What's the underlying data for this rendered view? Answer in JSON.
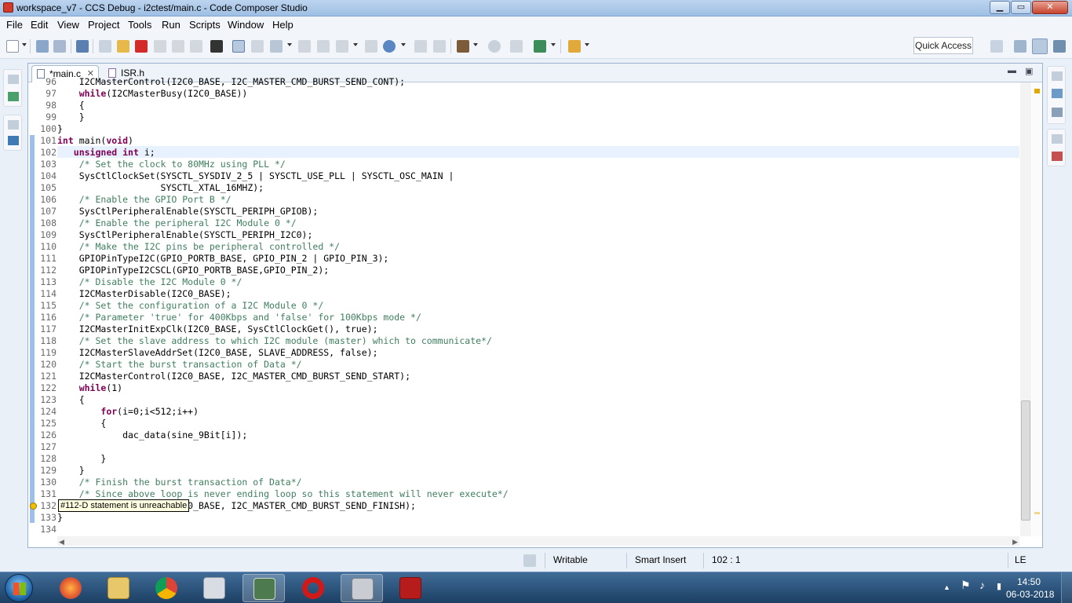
{
  "window": {
    "title": "workspace_v7 - CCS Debug - i2ctest/main.c - Code Composer Studio",
    "minimize_glyph": "▁",
    "maximize_glyph": "▭",
    "close_glyph": "✕"
  },
  "menu": [
    "File",
    "Edit",
    "View",
    "Project",
    "Tools",
    "Run",
    "Scripts",
    "Window",
    "Help"
  ],
  "toolbar": {
    "quick_access_label": "Quick Access",
    "icons": [
      "new-icon",
      "save-icon",
      "save-all-icon",
      "debug-view-icon",
      "resume-icon",
      "suspend-icon",
      "terminate-icon",
      "step-into-icon",
      "step-over-icon",
      "step-return-icon",
      "memory-icon",
      "build-icon",
      "debug-icon",
      "pin-icon",
      "tools-icon",
      "search-icon",
      "perspective-icon"
    ]
  },
  "tabs": [
    {
      "label": "*main.c",
      "close": "✕"
    },
    {
      "label": "ISR.h"
    }
  ],
  "editor": {
    "tooltip": "#112-D statement is unreachable",
    "lines": [
      {
        "num": "96",
        "text": "    I2CMasterControl(I2C0_BASE, I2C_MASTER_CMD_BURST_SEND_CONT);",
        "kind": "code"
      },
      {
        "num": "97",
        "text": "    while(I2CMasterBusy(I2C0_BASE))",
        "kind": "code"
      },
      {
        "num": "98",
        "text": "    {",
        "kind": "code"
      },
      {
        "num": "99",
        "text": "    }",
        "kind": "code"
      },
      {
        "num": "100",
        "text": "}",
        "kind": "code"
      },
      {
        "num": "101",
        "text": "int main(void)",
        "kind": "code"
      },
      {
        "num": "102",
        "text": "   unsigned int i;",
        "kind": "code"
      },
      {
        "num": "103",
        "text": "    /* Set the clock to 80MHz using PLL */",
        "kind": "comment"
      },
      {
        "num": "104",
        "text": "    SysCtlClockSet(SYSCTL_SYSDIV_2_5 | SYSCTL_USE_PLL | SYSCTL_OSC_MAIN |",
        "kind": "code"
      },
      {
        "num": "105",
        "text": "                   SYSCTL_XTAL_16MHZ);",
        "kind": "code"
      },
      {
        "num": "106",
        "text": "    /* Enable the GPIO Port B */",
        "kind": "comment"
      },
      {
        "num": "107",
        "text": "    SysCtlPeripheralEnable(SYSCTL_PERIPH_GPIOB);",
        "kind": "code"
      },
      {
        "num": "108",
        "text": "    /* Enable the peripheral I2C Module 0 */",
        "kind": "comment"
      },
      {
        "num": "109",
        "text": "    SysCtlPeripheralEnable(SYSCTL_PERIPH_I2C0);",
        "kind": "code"
      },
      {
        "num": "110",
        "text": "    /* Make the I2C pins be peripheral controlled */",
        "kind": "comment"
      },
      {
        "num": "111",
        "text": "    GPIOPinTypeI2C(GPIO_PORTB_BASE, GPIO_PIN_2 | GPIO_PIN_3);",
        "kind": "code"
      },
      {
        "num": "112",
        "text": "    GPIOPinTypeI2CSCL(GPIO_PORTB_BASE,GPIO_PIN_2);",
        "kind": "code"
      },
      {
        "num": "113",
        "text": "    /* Disable the I2C Module 0 */",
        "kind": "comment"
      },
      {
        "num": "114",
        "text": "    I2CMasterDisable(I2C0_BASE);",
        "kind": "code"
      },
      {
        "num": "115",
        "text": "    /* Set the configuration of a I2C Module 0 */",
        "kind": "comment"
      },
      {
        "num": "116",
        "text": "    /* Parameter 'true' for 400Kbps and 'false' for 100Kbps mode */",
        "kind": "comment"
      },
      {
        "num": "117",
        "text": "    I2CMasterInitExpClk(I2C0_BASE, SysCtlClockGet(), true);",
        "kind": "code"
      },
      {
        "num": "118",
        "text": "    /* Set the slave address to which I2C module (master) which to communicate*/",
        "kind": "comment"
      },
      {
        "num": "119",
        "text": "    I2CMasterSlaveAddrSet(I2C0_BASE, SLAVE_ADDRESS, false);",
        "kind": "code"
      },
      {
        "num": "120",
        "text": "    /* Start the burst transaction of Data */",
        "kind": "comment"
      },
      {
        "num": "121",
        "text": "    I2CMasterControl(I2C0_BASE, I2C_MASTER_CMD_BURST_SEND_START);",
        "kind": "code"
      },
      {
        "num": "122",
        "text": "    while(1)",
        "kind": "code"
      },
      {
        "num": "123",
        "text": "    {",
        "kind": "code"
      },
      {
        "num": "124",
        "text": "        for(i=0;i<512;i++)",
        "kind": "code"
      },
      {
        "num": "125",
        "text": "        {",
        "kind": "code"
      },
      {
        "num": "126",
        "text": "            dac_data(sine_9Bit[i]);",
        "kind": "code"
      },
      {
        "num": "127",
        "text": "",
        "kind": "code"
      },
      {
        "num": "128",
        "text": "        }",
        "kind": "code"
      },
      {
        "num": "129",
        "text": "    }",
        "kind": "code"
      },
      {
        "num": "130",
        "text": "    /* Finish the burst transaction of Data*/",
        "kind": "comment"
      },
      {
        "num": "131",
        "text": "    /* Since above loop is never ending loop so this statement will never execute*/",
        "kind": "comment"
      },
      {
        "num": "132",
        "text": "    I2CMasterControl(I2C0_BASE, I2C_MASTER_CMD_BURST_SEND_FINISH);",
        "kind": "code"
      },
      {
        "num": "133",
        "text": "}",
        "kind": "code"
      },
      {
        "num": "134",
        "text": "",
        "kind": "code"
      }
    ]
  },
  "status": {
    "writable": "Writable",
    "insert_mode": "Smart Insert",
    "cursor_pos": "102 : 1",
    "line_ending": "LE"
  },
  "taskbar": {
    "apps": [
      "start-button",
      "firefox",
      "file-explorer",
      "chrome",
      "calculator",
      "code-composer-studio",
      "opera",
      "virtualbox",
      "acrobat"
    ],
    "time": "14:50",
    "date": "06-03-2018"
  },
  "colors": {
    "keyword": "#7f0055",
    "comment": "#3f7f5f",
    "line_number": "#6a6a6a",
    "current_line": "#e8f2fe",
    "tooltip_bg": "#ffffe1"
  }
}
